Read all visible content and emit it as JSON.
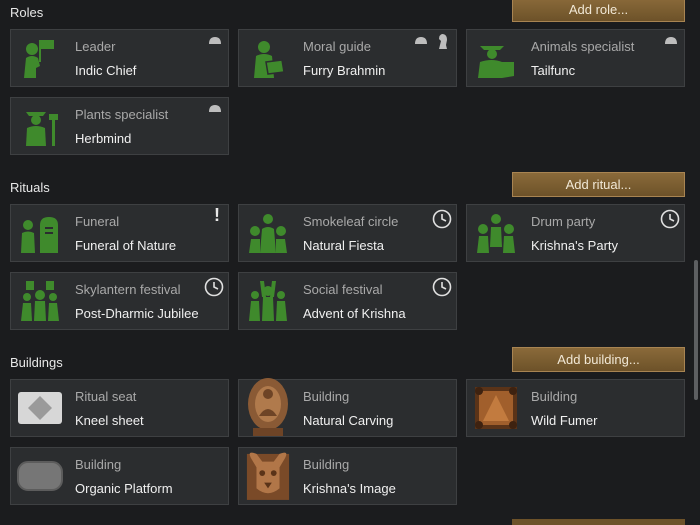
{
  "sections": {
    "roles": {
      "title": "Roles",
      "add_label": "Add role...",
      "cards": [
        {
          "line1": "Leader",
          "line2": "Indic Chief"
        },
        {
          "line1": "Moral guide",
          "line2": "Furry Brahmin"
        },
        {
          "line1": "Animals specialist",
          "line2": "Tailfunc"
        },
        {
          "line1": "Plants specialist",
          "line2": "Herbmind"
        }
      ]
    },
    "rituals": {
      "title": "Rituals",
      "add_label": "Add ritual...",
      "cards": [
        {
          "line1": "Funeral",
          "line2": "Funeral of Nature",
          "badge": "!"
        },
        {
          "line1": "Smokeleaf circle",
          "line2": "Natural Fiesta"
        },
        {
          "line1": "Drum party",
          "line2": "Krishna's Party"
        },
        {
          "line1": "Skylantern festival",
          "line2": "Post-Dharmic Jubilee"
        },
        {
          "line1": "Social festival",
          "line2": "Advent of Krishna"
        }
      ]
    },
    "buildings": {
      "title": "Buildings",
      "add_label": "Add building...",
      "cards": [
        {
          "line1": "Ritual seat",
          "line2": "Kneel sheet"
        },
        {
          "line1": "Building",
          "line2": "Natural Carving"
        },
        {
          "line1": "Building",
          "line2": "Wild Fumer"
        },
        {
          "line1": "Building",
          "line2": "Organic Platform"
        },
        {
          "line1": "Building",
          "line2": "Krishna's Image"
        }
      ]
    }
  },
  "colors": {
    "role_icon": "#3f8a2c",
    "button_bg": "#7a5e32",
    "card_bg": "#2b2d2f"
  }
}
